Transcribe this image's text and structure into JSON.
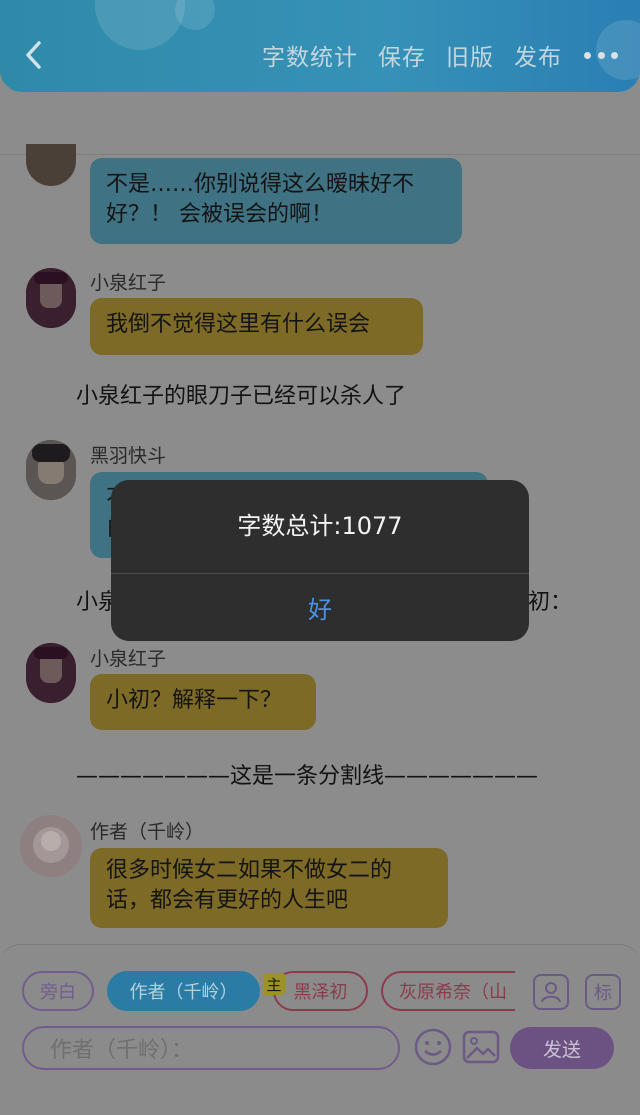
{
  "header": {
    "actions": [
      "字数统计",
      "保存",
      "旧版",
      "发布"
    ]
  },
  "messages": [
    {
      "speaker": "",
      "text": [
        "不是……你别说得这么暧昧好不",
        "好？！ 会被误会的啊！"
      ]
    },
    {
      "speaker": "小泉红子",
      "text": [
        "我倒不觉得这里有什么误会"
      ]
    },
    {
      "narration": "小泉红子的眼刀子已经可以杀人了"
    },
    {
      "speaker": "黑羽快斗",
      "text": [
        "不",
        "白"
      ]
    },
    {
      "narration_left": "小泉",
      "narration_right": "初："
    },
    {
      "speaker": "小泉红子",
      "text": [
        "小初？解释一下？"
      ]
    },
    {
      "narration": "———————这是一条分割线———————"
    },
    {
      "speaker": "作者（千岭）",
      "text": [
        "很多时候女二如果不做女二的",
        "话，都会有更好的人生吧"
      ]
    }
  ],
  "dialog": {
    "message": "字数总计:1077",
    "confirm": "好"
  },
  "roles": {
    "aside": "旁白",
    "author": "作者（千岭）",
    "host_tag": "主",
    "kuro": "黑泽初",
    "haibara": "灰原希奈（山",
    "tag_button": "标"
  },
  "input": {
    "placeholder": "作者（千岭）："
  },
  "send": "发送"
}
